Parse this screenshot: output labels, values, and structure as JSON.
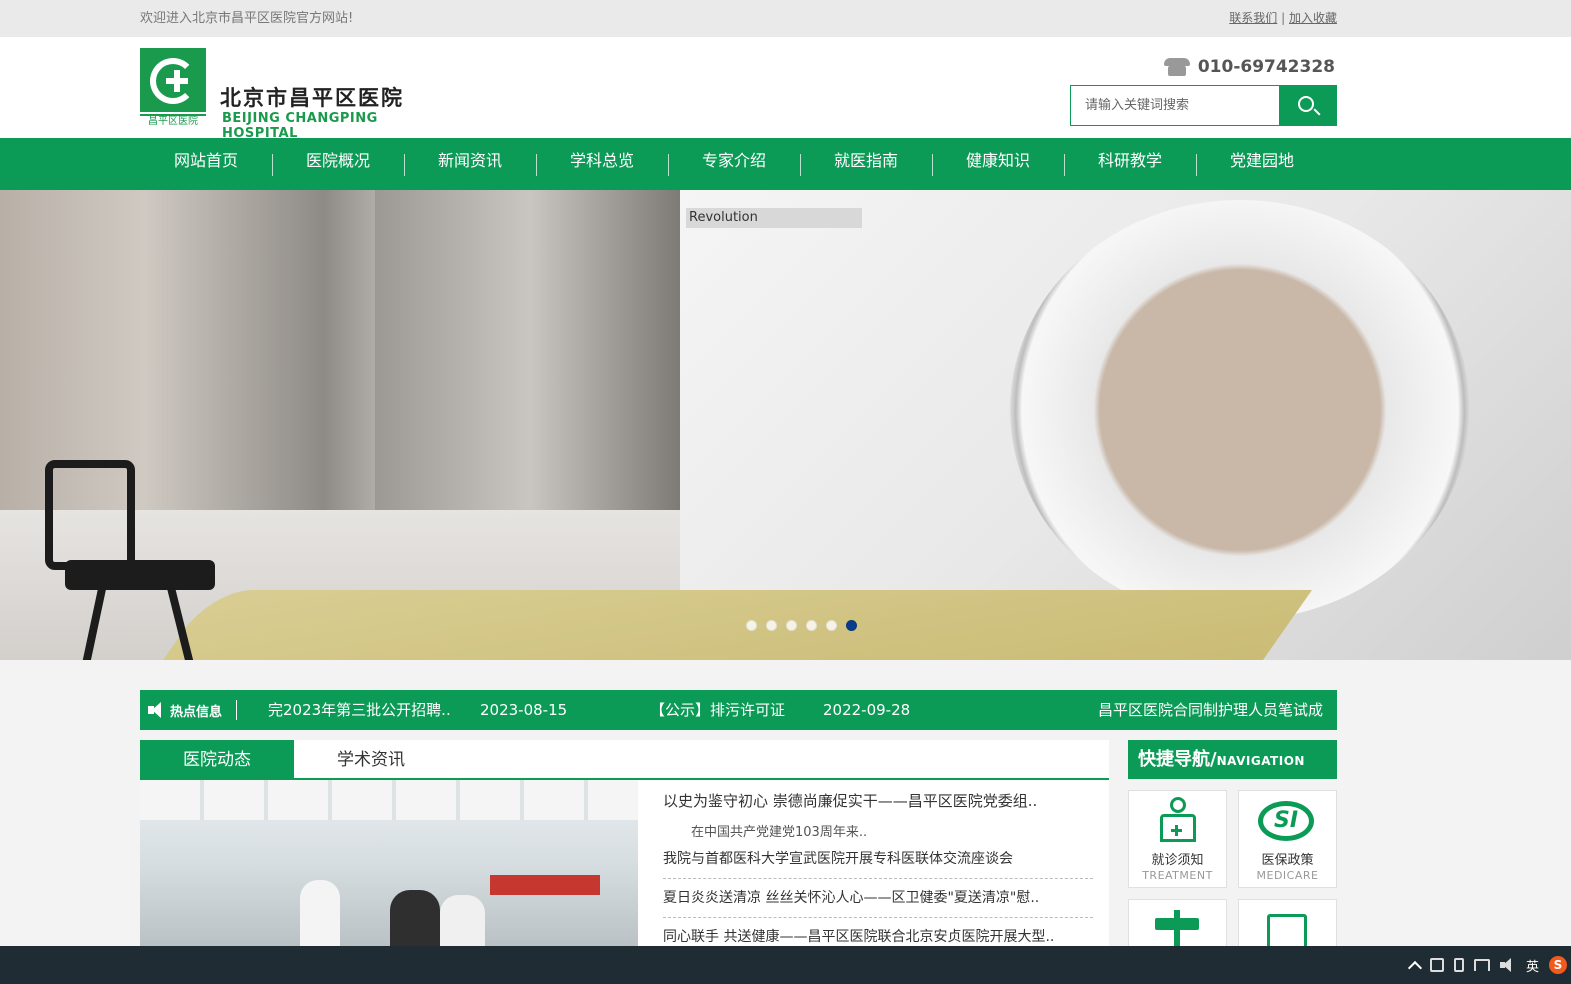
{
  "topbar": {
    "welcome": "欢迎进入北京市昌平区医院官方网站!",
    "contact_link": "联系我们",
    "separator": "|",
    "favorite_link": "加入收藏"
  },
  "header": {
    "logo_cn": "北京市昌平区医院",
    "logo_en": "BEIJING CHANGPING HOSPITAL",
    "logo_sub": "昌平区医院",
    "phone": "010-69742328",
    "search_placeholder": "请输入关键词搜索"
  },
  "nav": [
    "网站首页",
    "医院概况",
    "新闻资讯",
    "学科总览",
    "专家介绍",
    "就医指南",
    "健康知识",
    "科研教学",
    "党建园地"
  ],
  "banner": {
    "machine_label": "Revolution",
    "slide_count": 6,
    "active_slide": 6
  },
  "hot": {
    "label": "热点信息",
    "items": [
      {
        "text": "完2023年第三批公开招聘..",
        "date": "2023-08-15"
      },
      {
        "text": "【公示】排污许可证",
        "date": "2022-09-28"
      },
      {
        "text": "昌平区医院合同制护理人员笔试成",
        "date": ""
      }
    ]
  },
  "tabs": [
    "医院动态",
    "学术资讯"
  ],
  "news": {
    "lead_title": "以史为鉴守初心 崇德尚廉促实干——昌平区医院党委组..",
    "lead_summary": "在中国共产党建党103周年来..",
    "items": [
      "我院与首都医科大学宣武医院开展专科医联体交流座谈会",
      "夏日炎炎送清凉 丝丝关怀沁人心——区卫健委\"夏送清凉\"慰..",
      "同心联手 共送健康——昌平区医院联合北京安贞医院开展大型.."
    ]
  },
  "quicknav": {
    "title": "快捷导航/",
    "title_en": "NAVIGATION",
    "cards": [
      {
        "cn": "就诊须知",
        "en": "TREATMENT",
        "icon": "doctor-icon"
      },
      {
        "cn": "医保政策",
        "en": "MEDICARE",
        "icon": "si-icon",
        "glyph": "SI"
      },
      {
        "cn": "",
        "en": "",
        "icon": "signpost-icon"
      },
      {
        "cn": "",
        "en": "",
        "icon": "document-icon"
      }
    ]
  },
  "taskbar": {
    "ime": "英",
    "sogou": "S"
  },
  "colors": {
    "brand_green": "#0c9b57",
    "active_dot": "#0a3b8c"
  }
}
